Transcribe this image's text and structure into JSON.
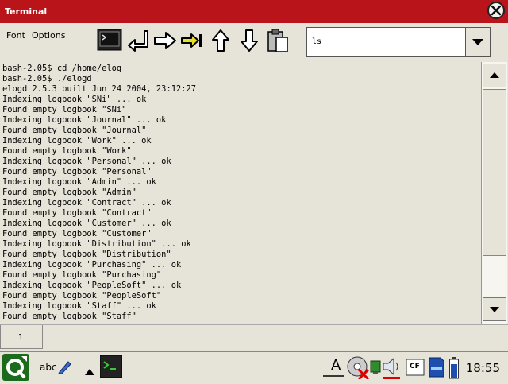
{
  "window": {
    "title": "Terminal"
  },
  "menu": {
    "font": "Font",
    "options": "Options"
  },
  "command": {
    "value": "ls"
  },
  "terminal": {
    "lines": [
      "bash-2.05$ cd /home/elog",
      "bash-2.05$ ./elogd",
      "elogd 2.5.3 built Jun 24 2004, 23:12:27",
      "Indexing logbook \"SNi\" ... ok",
      "Found empty logbook \"SNi\"",
      "Indexing logbook \"Journal\" ... ok",
      "Found empty logbook \"Journal\"",
      "Indexing logbook \"Work\" ... ok",
      "Found empty logbook \"Work\"",
      "Indexing logbook \"Personal\" ... ok",
      "Found empty logbook \"Personal\"",
      "Indexing logbook \"Admin\" ... ok",
      "Found empty logbook \"Admin\"",
      "Indexing logbook \"Contract\" ... ok",
      "Found empty logbook \"Contract\"",
      "Indexing logbook \"Customer\" ... ok",
      "Found empty logbook \"Customer\"",
      "Indexing logbook \"Distribution\" ... ok",
      "Found empty logbook \"Distribution\"",
      "Indexing logbook \"Purchasing\" ... ok",
      "Found empty logbook \"Purchasing\"",
      "Indexing logbook \"PeopleSoft\" ... ok",
      "Found empty logbook \"PeopleSoft\"",
      "Indexing logbook \"Staff\" ... ok",
      "Found empty logbook \"Staff\""
    ]
  },
  "tabs": [
    {
      "label": "1"
    }
  ],
  "taskbar": {
    "input_label": "abc",
    "text_tool_label": "A",
    "cf_label": "CF",
    "clock": "18:55"
  },
  "colors": {
    "titlebar": "#b8141a",
    "background": "#e6e3d8",
    "accent_green": "#2e8b2e"
  },
  "icons": [
    "close-icon",
    "terminal-icon",
    "enter-icon",
    "right-arrow-icon",
    "tab-arrow-icon",
    "up-arrow-icon",
    "down-arrow-icon",
    "paste-icon",
    "dropdown-icon",
    "scroll-up-icon",
    "scroll-down-icon",
    "q-menu-icon",
    "pen-icon",
    "triangle-up-icon",
    "terminal-app-icon",
    "text-tool-icon",
    "media-icon",
    "network-icon",
    "volume-icon",
    "cf-card-icon",
    "sd-card-icon",
    "battery-icon"
  ]
}
